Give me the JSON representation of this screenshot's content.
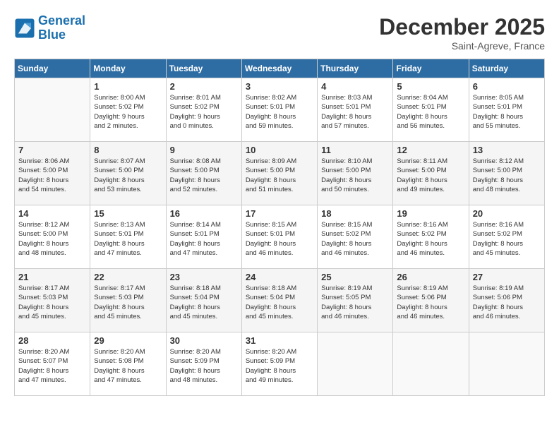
{
  "header": {
    "logo_line1": "General",
    "logo_line2": "Blue",
    "month_title": "December 2025",
    "location": "Saint-Agreve, France"
  },
  "weekdays": [
    "Sunday",
    "Monday",
    "Tuesday",
    "Wednesday",
    "Thursday",
    "Friday",
    "Saturday"
  ],
  "weeks": [
    [
      {
        "day": "",
        "info": ""
      },
      {
        "day": "1",
        "info": "Sunrise: 8:00 AM\nSunset: 5:02 PM\nDaylight: 9 hours\nand 2 minutes."
      },
      {
        "day": "2",
        "info": "Sunrise: 8:01 AM\nSunset: 5:02 PM\nDaylight: 9 hours\nand 0 minutes."
      },
      {
        "day": "3",
        "info": "Sunrise: 8:02 AM\nSunset: 5:01 PM\nDaylight: 8 hours\nand 59 minutes."
      },
      {
        "day": "4",
        "info": "Sunrise: 8:03 AM\nSunset: 5:01 PM\nDaylight: 8 hours\nand 57 minutes."
      },
      {
        "day": "5",
        "info": "Sunrise: 8:04 AM\nSunset: 5:01 PM\nDaylight: 8 hours\nand 56 minutes."
      },
      {
        "day": "6",
        "info": "Sunrise: 8:05 AM\nSunset: 5:01 PM\nDaylight: 8 hours\nand 55 minutes."
      }
    ],
    [
      {
        "day": "7",
        "info": "Sunrise: 8:06 AM\nSunset: 5:00 PM\nDaylight: 8 hours\nand 54 minutes."
      },
      {
        "day": "8",
        "info": "Sunrise: 8:07 AM\nSunset: 5:00 PM\nDaylight: 8 hours\nand 53 minutes."
      },
      {
        "day": "9",
        "info": "Sunrise: 8:08 AM\nSunset: 5:00 PM\nDaylight: 8 hours\nand 52 minutes."
      },
      {
        "day": "10",
        "info": "Sunrise: 8:09 AM\nSunset: 5:00 PM\nDaylight: 8 hours\nand 51 minutes."
      },
      {
        "day": "11",
        "info": "Sunrise: 8:10 AM\nSunset: 5:00 PM\nDaylight: 8 hours\nand 50 minutes."
      },
      {
        "day": "12",
        "info": "Sunrise: 8:11 AM\nSunset: 5:00 PM\nDaylight: 8 hours\nand 49 minutes."
      },
      {
        "day": "13",
        "info": "Sunrise: 8:12 AM\nSunset: 5:00 PM\nDaylight: 8 hours\nand 48 minutes."
      }
    ],
    [
      {
        "day": "14",
        "info": "Sunrise: 8:12 AM\nSunset: 5:00 PM\nDaylight: 8 hours\nand 48 minutes."
      },
      {
        "day": "15",
        "info": "Sunrise: 8:13 AM\nSunset: 5:01 PM\nDaylight: 8 hours\nand 47 minutes."
      },
      {
        "day": "16",
        "info": "Sunrise: 8:14 AM\nSunset: 5:01 PM\nDaylight: 8 hours\nand 47 minutes."
      },
      {
        "day": "17",
        "info": "Sunrise: 8:15 AM\nSunset: 5:01 PM\nDaylight: 8 hours\nand 46 minutes."
      },
      {
        "day": "18",
        "info": "Sunrise: 8:15 AM\nSunset: 5:02 PM\nDaylight: 8 hours\nand 46 minutes."
      },
      {
        "day": "19",
        "info": "Sunrise: 8:16 AM\nSunset: 5:02 PM\nDaylight: 8 hours\nand 46 minutes."
      },
      {
        "day": "20",
        "info": "Sunrise: 8:16 AM\nSunset: 5:02 PM\nDaylight: 8 hours\nand 45 minutes."
      }
    ],
    [
      {
        "day": "21",
        "info": "Sunrise: 8:17 AM\nSunset: 5:03 PM\nDaylight: 8 hours\nand 45 minutes."
      },
      {
        "day": "22",
        "info": "Sunrise: 8:17 AM\nSunset: 5:03 PM\nDaylight: 8 hours\nand 45 minutes."
      },
      {
        "day": "23",
        "info": "Sunrise: 8:18 AM\nSunset: 5:04 PM\nDaylight: 8 hours\nand 45 minutes."
      },
      {
        "day": "24",
        "info": "Sunrise: 8:18 AM\nSunset: 5:04 PM\nDaylight: 8 hours\nand 45 minutes."
      },
      {
        "day": "25",
        "info": "Sunrise: 8:19 AM\nSunset: 5:05 PM\nDaylight: 8 hours\nand 46 minutes."
      },
      {
        "day": "26",
        "info": "Sunrise: 8:19 AM\nSunset: 5:06 PM\nDaylight: 8 hours\nand 46 minutes."
      },
      {
        "day": "27",
        "info": "Sunrise: 8:19 AM\nSunset: 5:06 PM\nDaylight: 8 hours\nand 46 minutes."
      }
    ],
    [
      {
        "day": "28",
        "info": "Sunrise: 8:20 AM\nSunset: 5:07 PM\nDaylight: 8 hours\nand 47 minutes."
      },
      {
        "day": "29",
        "info": "Sunrise: 8:20 AM\nSunset: 5:08 PM\nDaylight: 8 hours\nand 47 minutes."
      },
      {
        "day": "30",
        "info": "Sunrise: 8:20 AM\nSunset: 5:09 PM\nDaylight: 8 hours\nand 48 minutes."
      },
      {
        "day": "31",
        "info": "Sunrise: 8:20 AM\nSunset: 5:09 PM\nDaylight: 8 hours\nand 49 minutes."
      },
      {
        "day": "",
        "info": ""
      },
      {
        "day": "",
        "info": ""
      },
      {
        "day": "",
        "info": ""
      }
    ]
  ]
}
